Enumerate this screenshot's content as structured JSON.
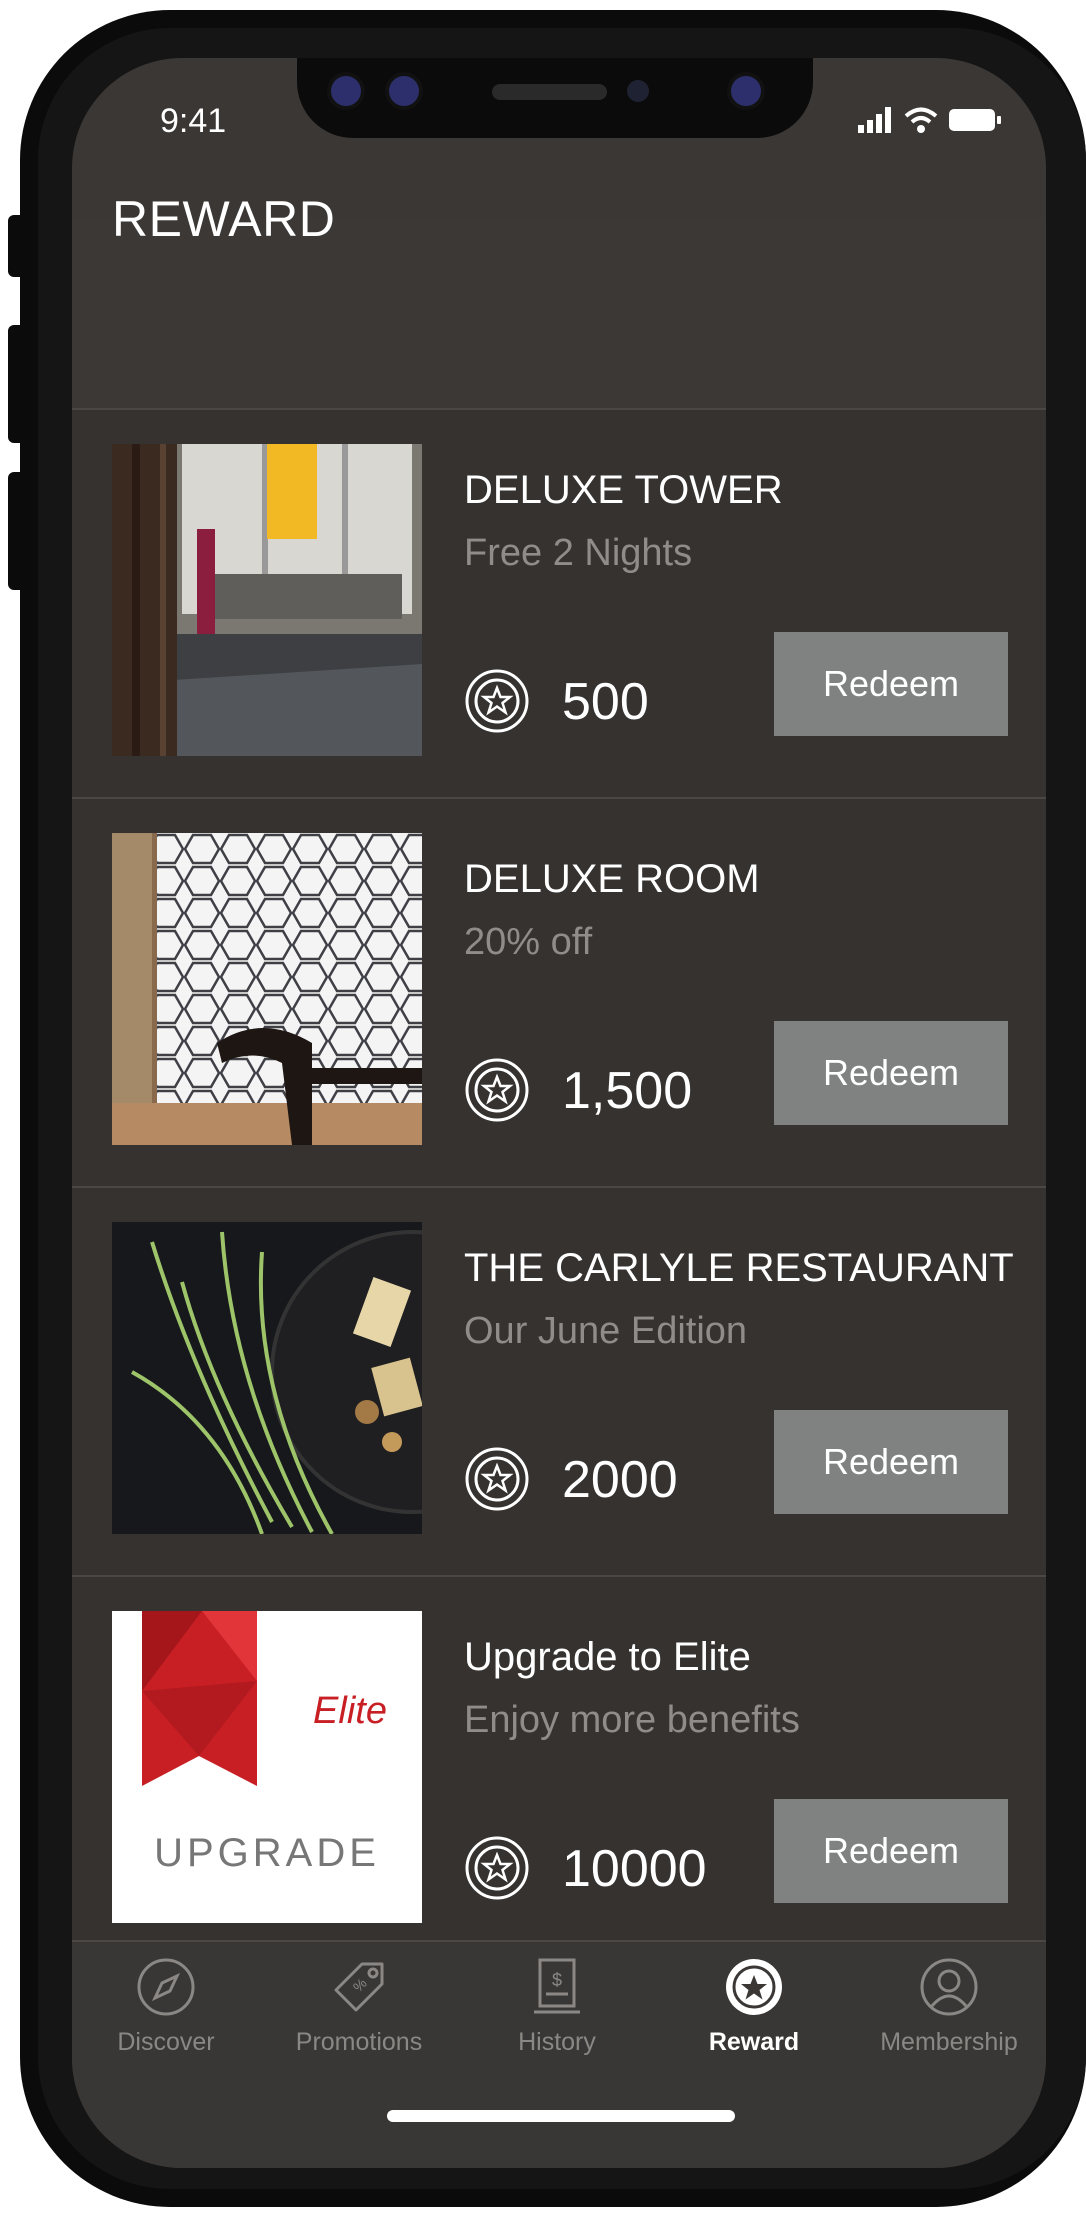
{
  "status_bar": {
    "time": "9:41"
  },
  "header": {
    "title": "REWARD"
  },
  "rewards": [
    {
      "title": "DELUXE TOWER",
      "subtitle": "Free 2 Nights",
      "points": "500",
      "button": "Redeem",
      "image": "hotel-lobby-photo"
    },
    {
      "title": "DELUXE ROOM",
      "subtitle": "20% off",
      "points": "1,500",
      "button": "Redeem",
      "image": "room-lattice-photo"
    },
    {
      "title": "THE CARLYLE RESTAURANT",
      "subtitle": "Our June Edition",
      "points": "2000",
      "button": "Redeem",
      "image": "restaurant-dish-photo"
    },
    {
      "title": "Upgrade to Elite",
      "subtitle": "Enjoy more benefits",
      "points": "10000",
      "button": "Redeem",
      "image": "upgrade-elite-graphic",
      "image_text": {
        "elite": "Elite",
        "upgrade": "UPGRADE"
      }
    }
  ],
  "tab_bar": {
    "active": "Reward",
    "items": [
      {
        "label": "Discover",
        "icon": "compass-icon"
      },
      {
        "label": "Promotions",
        "icon": "tag-icon"
      },
      {
        "label": "History",
        "icon": "receipt-icon"
      },
      {
        "label": "Reward",
        "icon": "reward-star-icon"
      },
      {
        "label": "Membership",
        "icon": "user-icon"
      }
    ]
  },
  "colors": {
    "background": "#3a3735",
    "button": "#7f8280",
    "accent_red": "#c81f24"
  }
}
